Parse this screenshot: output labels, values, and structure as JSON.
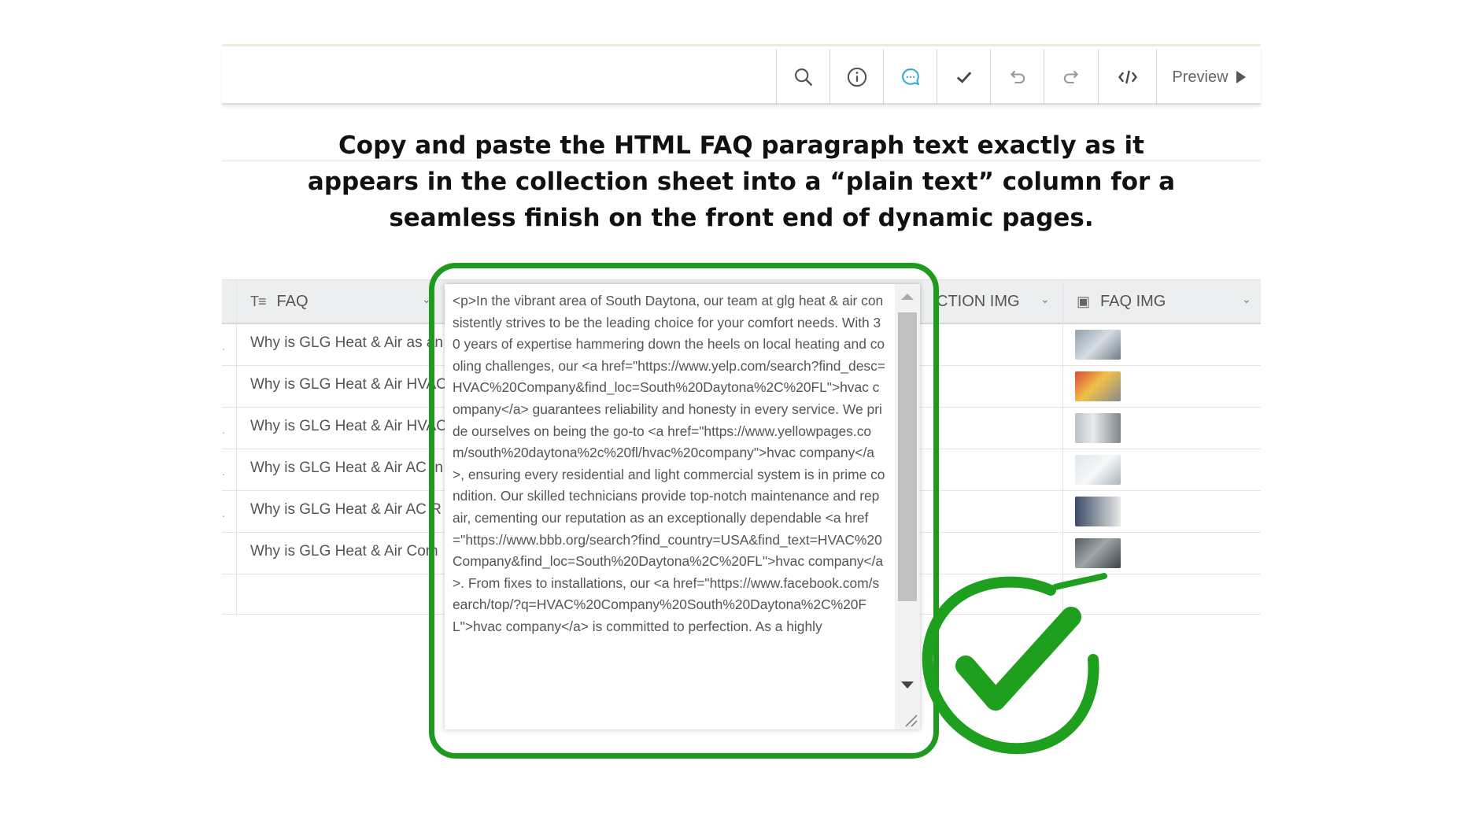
{
  "toolbar": {
    "buttons": [
      "search-icon",
      "info-icon",
      "comment-icon",
      "check-icon",
      "undo-icon",
      "redo-icon",
      "code-icon"
    ],
    "preview_label": "Preview",
    "active_color": "#3aa7d8"
  },
  "caption": {
    "line1": "Copy and paste the HTML FAQ paragraph text exactly as it",
    "line2": "appears in the collection sheet into a “plain text” column for a",
    "line3": "seamless finish on the front end of dynamic pages."
  },
  "table": {
    "columns": {
      "faq": "FAQ",
      "section_img": "CTION IMG",
      "faq_img": "FAQ IMG"
    },
    "rows": [
      {
        "question": "Why is GLG Heat & Air as an"
      },
      {
        "question": "Why is GLG Heat & Air HVAC"
      },
      {
        "question": "Why is GLG Heat & Air HVAC"
      },
      {
        "question": "Why is GLG Heat & Air AC In"
      },
      {
        "question": "Why is GLG Heat & Air AC R"
      },
      {
        "question": "Why is GLG Heat & Air Com"
      }
    ]
  },
  "popup": {
    "text": "<p>In the vibrant area of South Daytona, our team at glg heat & air consistently strives to be the leading choice for your comfort needs. With 30 years of expertise hammering down the heels on local heating and cooling challenges, our <a href=\"https://www.yelp.com/search?find_desc=HVAC%20Company&find_loc=South%20Daytona%2C%20FL\">hvac company</a> guarantees reliability and honesty in every service. We pride ourselves on being the go-to <a href=\"https://www.yellowpages.com/south%20daytona%2c%20fl/hvac%20company\">hvac company</a>, ensuring every residential and light commercial system is in prime condition. Our skilled technicians provide top-notch maintenance and repair, cementing our reputation as an exceptionally dependable <a href=\"https://www.bbb.org/search?find_country=USA&find_text=HVAC%20Company&find_loc=South%20Daytona%2C%20FL\">hvac company</a>. From fixes to installations, our <a href=\"https://www.facebook.com/search/top/?q=HVAC%20Company%20South%20Daytona%2C%20FL\">hvac company</a> is committed to perfection. As a highly"
  },
  "colors": {
    "highlight_green": "#1e9b1e",
    "check_green": "#1ea01e"
  }
}
